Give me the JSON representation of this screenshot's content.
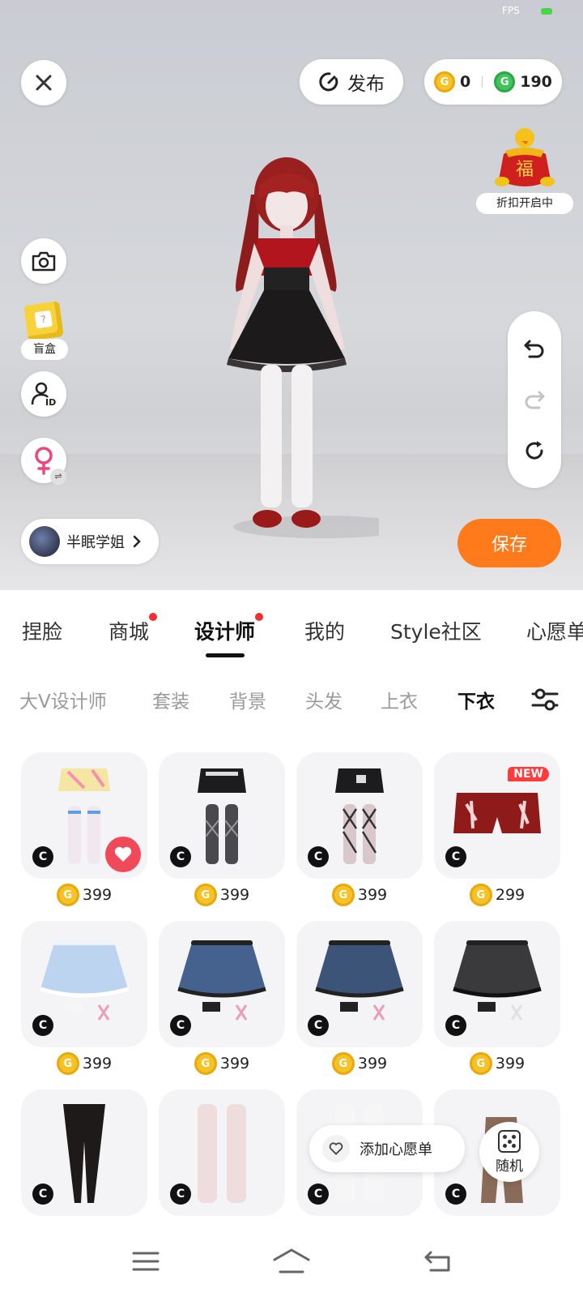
{
  "status": {
    "fps_label": "FPS"
  },
  "toolbar": {
    "publish_label": "发布",
    "gold_balance": "0",
    "green_balance": "190",
    "coin_symbol": "G"
  },
  "promo": {
    "label": "折扣开启中",
    "glyph": "福"
  },
  "side": {
    "blindbox_label": "盲盒",
    "id_label": "ID",
    "gender_swap": "⇌"
  },
  "user": {
    "name": "半眠学姐"
  },
  "save_label": "保存",
  "main_tabs": [
    {
      "label": "捏脸",
      "dot": false
    },
    {
      "label": "商城",
      "dot": true
    },
    {
      "label": "设计师",
      "dot": true,
      "active": true
    },
    {
      "label": "我的",
      "dot": false
    },
    {
      "label": "Style社区",
      "dot": false
    },
    {
      "label": "心愿单",
      "dot": false
    }
  ],
  "sub_tabs": [
    {
      "label": "大V设计师"
    },
    {
      "label": "套装"
    },
    {
      "label": "背景"
    },
    {
      "label": "头发"
    },
    {
      "label": "上衣"
    },
    {
      "label": "下衣",
      "active": true
    }
  ],
  "items": [
    {
      "name": "pastel-skirt-stockings",
      "price": "399",
      "badge": "C",
      "heart": true
    },
    {
      "name": "black-skirt-lace-stockings",
      "price": "399",
      "badge": "C"
    },
    {
      "name": "black-skirt-cross-stockings",
      "price": "399",
      "badge": "C"
    },
    {
      "name": "red-print-shorts",
      "price": "299",
      "badge": "C",
      "new_label": "NEW"
    },
    {
      "name": "light-blue-ruffle-skirt",
      "price": "399",
      "badge": "C"
    },
    {
      "name": "denim-ruffle-skirt",
      "price": "399",
      "badge": "C"
    },
    {
      "name": "denim-ruffle-skirt-dark",
      "price": "399",
      "badge": "C"
    },
    {
      "name": "black-denim-ruffle-skirt",
      "price": "399",
      "badge": "C"
    },
    {
      "name": "black-tights",
      "badge": "C"
    },
    {
      "name": "pink-stockings",
      "badge": "C"
    },
    {
      "name": "white-knee-socks",
      "badge": "C"
    },
    {
      "name": "brown-cargo-pants",
      "badge": "C"
    }
  ],
  "wishlist_label": "添加心愿单",
  "random_label": "随机",
  "colors": {
    "accent": "#ff7a1a",
    "tab_dot": "#f03030",
    "heart": "#f04a5a",
    "new_badge": "#ff3b3b"
  }
}
